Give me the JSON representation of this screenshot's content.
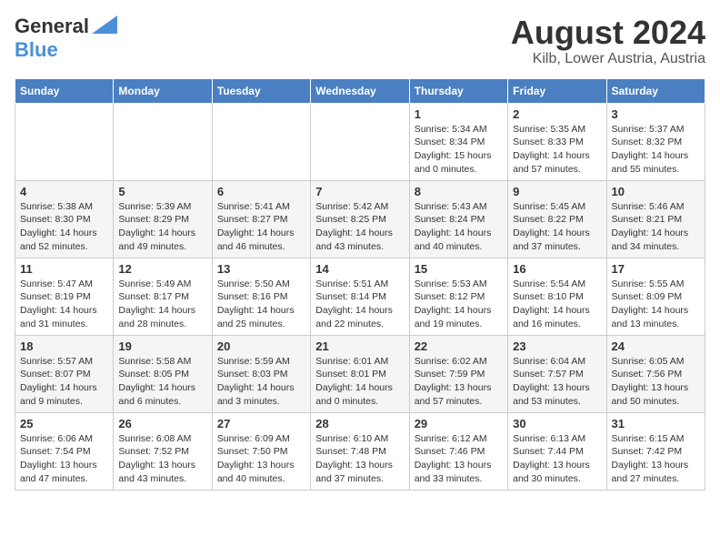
{
  "header": {
    "logo_line1": "General",
    "logo_line2": "Blue",
    "month": "August 2024",
    "location": "Kilb, Lower Austria, Austria"
  },
  "weekdays": [
    "Sunday",
    "Monday",
    "Tuesday",
    "Wednesday",
    "Thursday",
    "Friday",
    "Saturday"
  ],
  "weeks": [
    [
      {
        "day": "",
        "info": ""
      },
      {
        "day": "",
        "info": ""
      },
      {
        "day": "",
        "info": ""
      },
      {
        "day": "",
        "info": ""
      },
      {
        "day": "1",
        "info": "Sunrise: 5:34 AM\nSunset: 8:34 PM\nDaylight: 15 hours and 0 minutes."
      },
      {
        "day": "2",
        "info": "Sunrise: 5:35 AM\nSunset: 8:33 PM\nDaylight: 14 hours and 57 minutes."
      },
      {
        "day": "3",
        "info": "Sunrise: 5:37 AM\nSunset: 8:32 PM\nDaylight: 14 hours and 55 minutes."
      }
    ],
    [
      {
        "day": "4",
        "info": "Sunrise: 5:38 AM\nSunset: 8:30 PM\nDaylight: 14 hours and 52 minutes."
      },
      {
        "day": "5",
        "info": "Sunrise: 5:39 AM\nSunset: 8:29 PM\nDaylight: 14 hours and 49 minutes."
      },
      {
        "day": "6",
        "info": "Sunrise: 5:41 AM\nSunset: 8:27 PM\nDaylight: 14 hours and 46 minutes."
      },
      {
        "day": "7",
        "info": "Sunrise: 5:42 AM\nSunset: 8:25 PM\nDaylight: 14 hours and 43 minutes."
      },
      {
        "day": "8",
        "info": "Sunrise: 5:43 AM\nSunset: 8:24 PM\nDaylight: 14 hours and 40 minutes."
      },
      {
        "day": "9",
        "info": "Sunrise: 5:45 AM\nSunset: 8:22 PM\nDaylight: 14 hours and 37 minutes."
      },
      {
        "day": "10",
        "info": "Sunrise: 5:46 AM\nSunset: 8:21 PM\nDaylight: 14 hours and 34 minutes."
      }
    ],
    [
      {
        "day": "11",
        "info": "Sunrise: 5:47 AM\nSunset: 8:19 PM\nDaylight: 14 hours and 31 minutes."
      },
      {
        "day": "12",
        "info": "Sunrise: 5:49 AM\nSunset: 8:17 PM\nDaylight: 14 hours and 28 minutes."
      },
      {
        "day": "13",
        "info": "Sunrise: 5:50 AM\nSunset: 8:16 PM\nDaylight: 14 hours and 25 minutes."
      },
      {
        "day": "14",
        "info": "Sunrise: 5:51 AM\nSunset: 8:14 PM\nDaylight: 14 hours and 22 minutes."
      },
      {
        "day": "15",
        "info": "Sunrise: 5:53 AM\nSunset: 8:12 PM\nDaylight: 14 hours and 19 minutes."
      },
      {
        "day": "16",
        "info": "Sunrise: 5:54 AM\nSunset: 8:10 PM\nDaylight: 14 hours and 16 minutes."
      },
      {
        "day": "17",
        "info": "Sunrise: 5:55 AM\nSunset: 8:09 PM\nDaylight: 14 hours and 13 minutes."
      }
    ],
    [
      {
        "day": "18",
        "info": "Sunrise: 5:57 AM\nSunset: 8:07 PM\nDaylight: 14 hours and 9 minutes."
      },
      {
        "day": "19",
        "info": "Sunrise: 5:58 AM\nSunset: 8:05 PM\nDaylight: 14 hours and 6 minutes."
      },
      {
        "day": "20",
        "info": "Sunrise: 5:59 AM\nSunset: 8:03 PM\nDaylight: 14 hours and 3 minutes."
      },
      {
        "day": "21",
        "info": "Sunrise: 6:01 AM\nSunset: 8:01 PM\nDaylight: 14 hours and 0 minutes."
      },
      {
        "day": "22",
        "info": "Sunrise: 6:02 AM\nSunset: 7:59 PM\nDaylight: 13 hours and 57 minutes."
      },
      {
        "day": "23",
        "info": "Sunrise: 6:04 AM\nSunset: 7:57 PM\nDaylight: 13 hours and 53 minutes."
      },
      {
        "day": "24",
        "info": "Sunrise: 6:05 AM\nSunset: 7:56 PM\nDaylight: 13 hours and 50 minutes."
      }
    ],
    [
      {
        "day": "25",
        "info": "Sunrise: 6:06 AM\nSunset: 7:54 PM\nDaylight: 13 hours and 47 minutes."
      },
      {
        "day": "26",
        "info": "Sunrise: 6:08 AM\nSunset: 7:52 PM\nDaylight: 13 hours and 43 minutes."
      },
      {
        "day": "27",
        "info": "Sunrise: 6:09 AM\nSunset: 7:50 PM\nDaylight: 13 hours and 40 minutes."
      },
      {
        "day": "28",
        "info": "Sunrise: 6:10 AM\nSunset: 7:48 PM\nDaylight: 13 hours and 37 minutes."
      },
      {
        "day": "29",
        "info": "Sunrise: 6:12 AM\nSunset: 7:46 PM\nDaylight: 13 hours and 33 minutes."
      },
      {
        "day": "30",
        "info": "Sunrise: 6:13 AM\nSunset: 7:44 PM\nDaylight: 13 hours and 30 minutes."
      },
      {
        "day": "31",
        "info": "Sunrise: 6:15 AM\nSunset: 7:42 PM\nDaylight: 13 hours and 27 minutes."
      }
    ]
  ]
}
